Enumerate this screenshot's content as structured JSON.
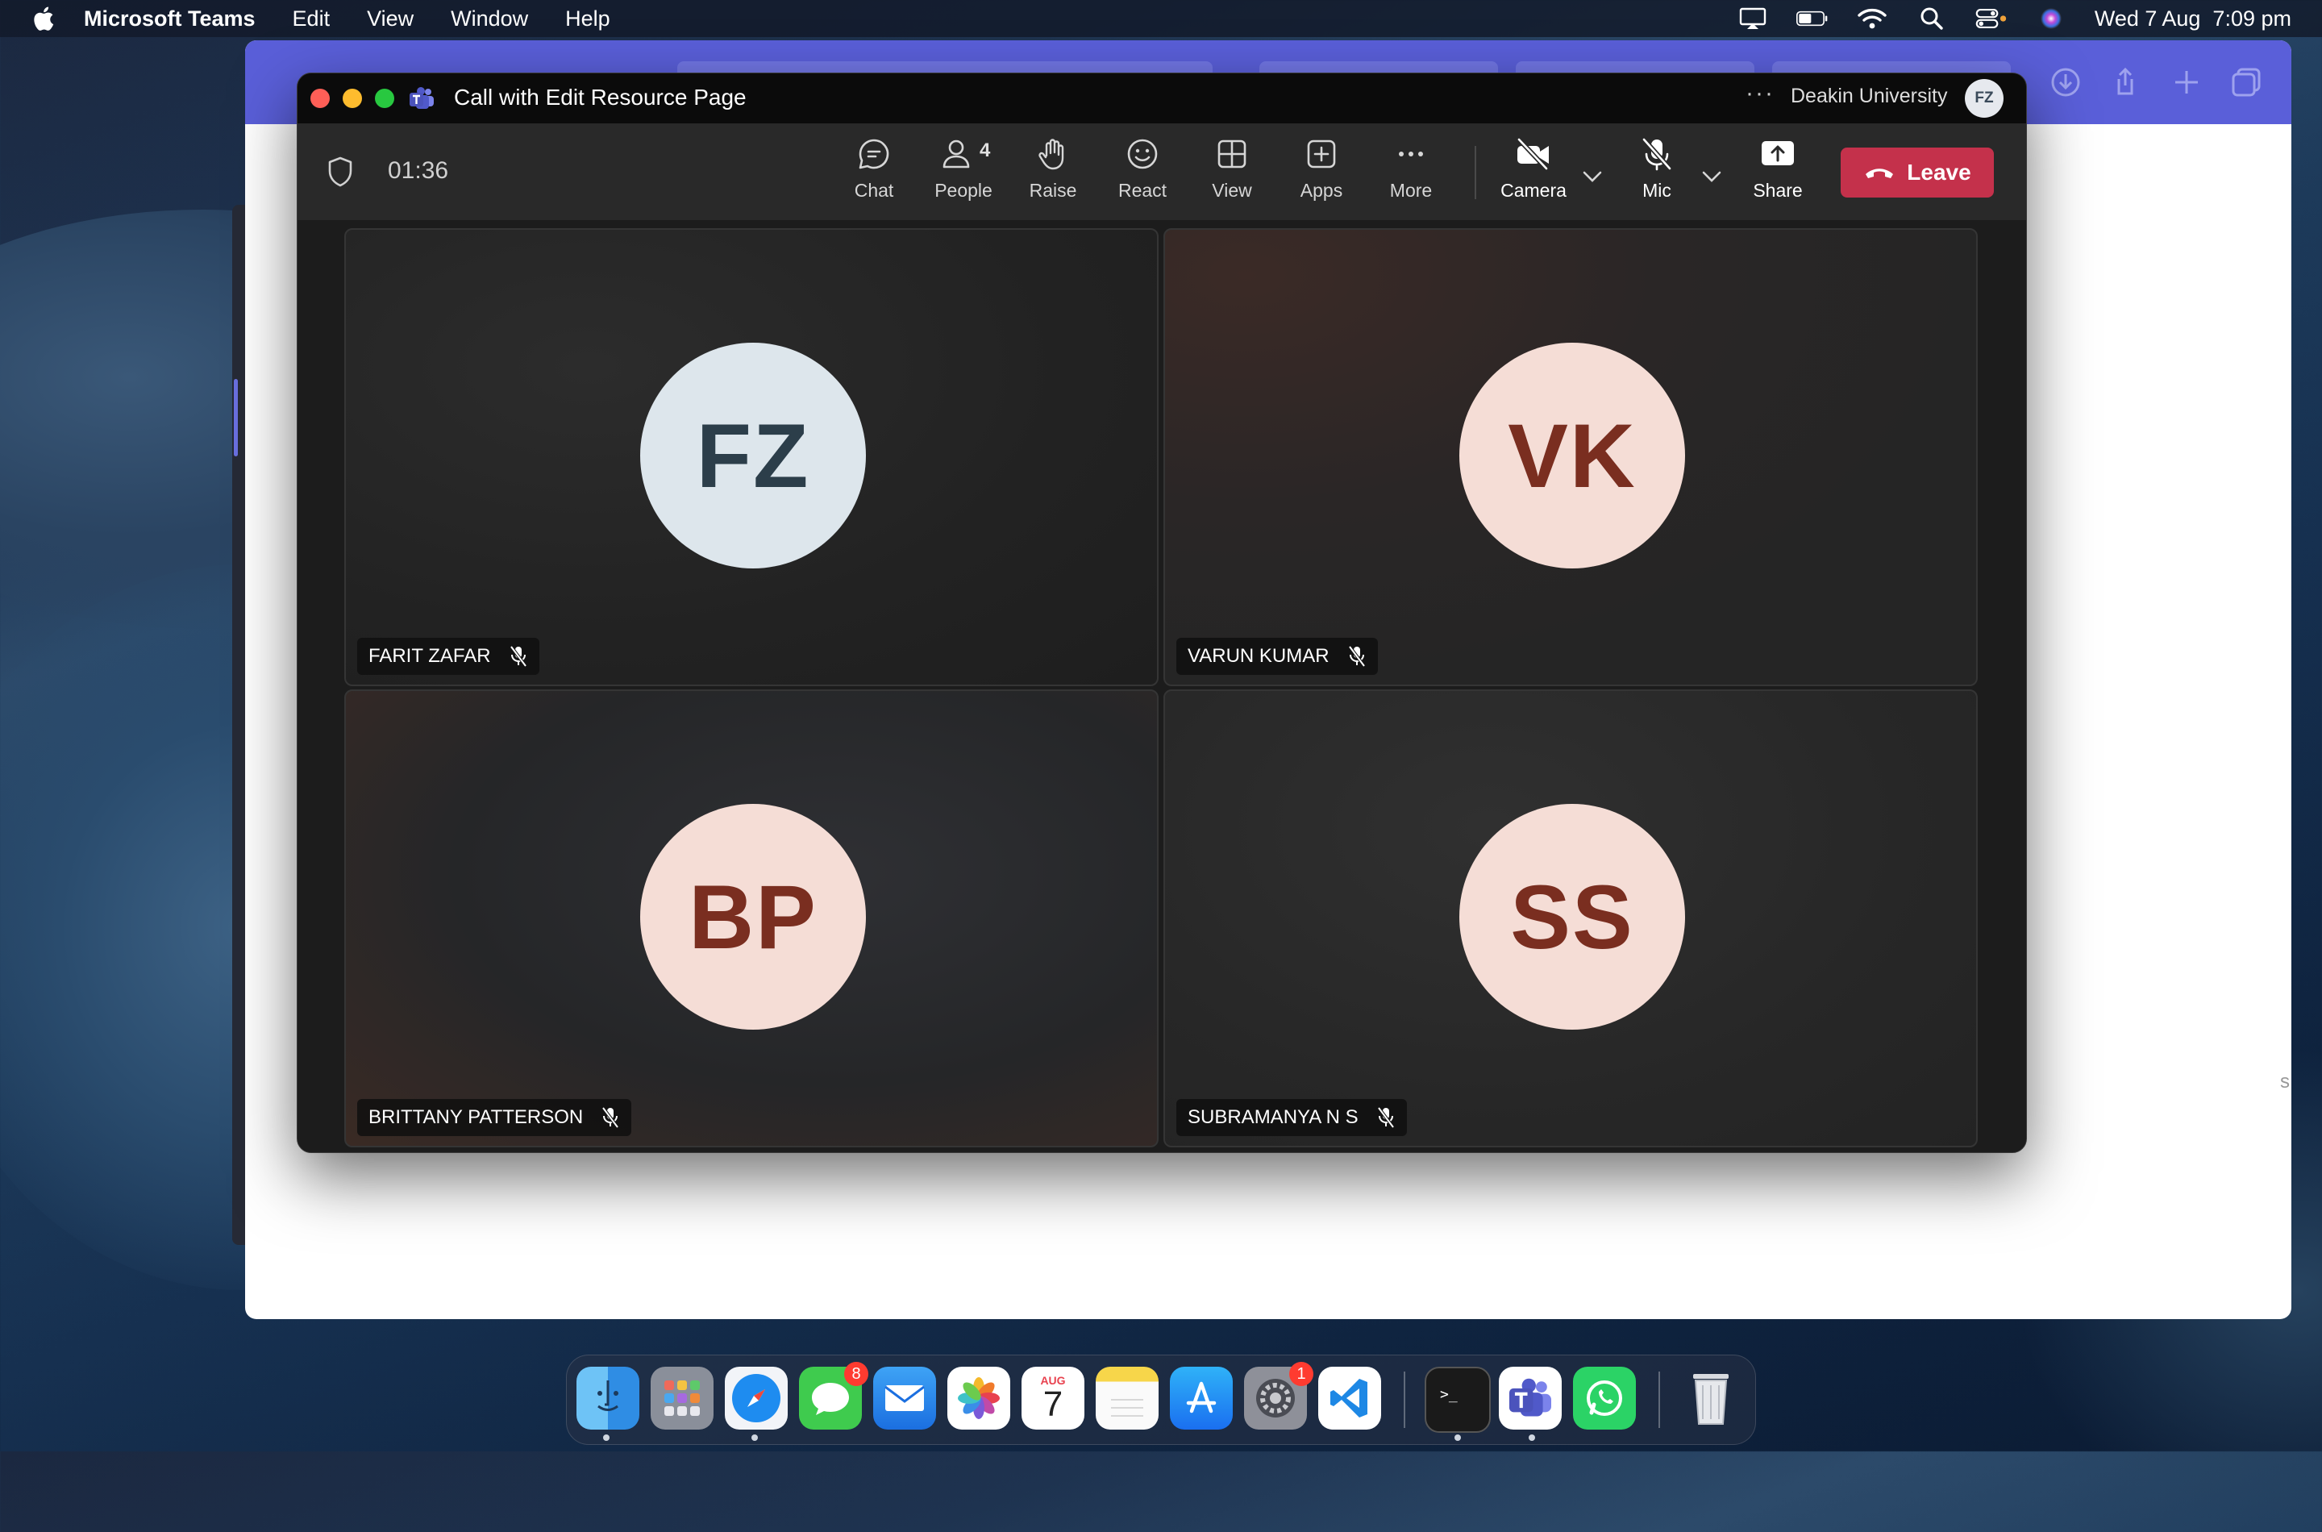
{
  "menubar": {
    "app_name": "Microsoft Teams",
    "items": [
      "Edit",
      "View",
      "Window",
      "Help"
    ],
    "datetime": "Wed 7 Aug  7:09 pm",
    "status_icons": [
      "display-icon",
      "battery-icon",
      "wifi-icon",
      "spotlight-icon",
      "control-center-icon",
      "siri-icon"
    ]
  },
  "window": {
    "title": "Call with Edit Resource Page",
    "more": "···",
    "organization": "Deakin University",
    "user_initials": "FZ"
  },
  "toolbar": {
    "timer": "01:36",
    "chat": "Chat",
    "people": "People",
    "people_count": "4",
    "raise": "Raise",
    "react": "React",
    "view": "View",
    "apps": "Apps",
    "more": "More",
    "camera": "Camera",
    "mic": "Mic",
    "share": "Share",
    "leave": "Leave",
    "leave_color": "#c4314b"
  },
  "participants": [
    {
      "initials": "FZ",
      "name": "FARIT ZAFAR",
      "muted": true,
      "avatar_bg": "#dde6ec"
    },
    {
      "initials": "VK",
      "name": "VARUN KUMAR",
      "muted": true,
      "avatar_bg": "#f5ddd6"
    },
    {
      "initials": "BP",
      "name": "BRITTANY PATTERSON",
      "muted": true,
      "avatar_bg": "#f5ddd6"
    },
    {
      "initials": "SS",
      "name": "SUBRAMANYA N S",
      "muted": true,
      "avatar_bg": "#f5ddd6"
    }
  ],
  "dock": {
    "apps": [
      "Finder",
      "Launchpad",
      "Safari",
      "Messages",
      "Mail",
      "Photos",
      "Calendar",
      "Notes",
      "App Store",
      "System Settings",
      "Visual Studio Code",
      "Terminal",
      "Microsoft Teams",
      "WhatsApp",
      "Trash"
    ],
    "messages_badge": "8",
    "settings_badge": "1",
    "calendar_month": "AUG",
    "calendar_day": "7"
  }
}
